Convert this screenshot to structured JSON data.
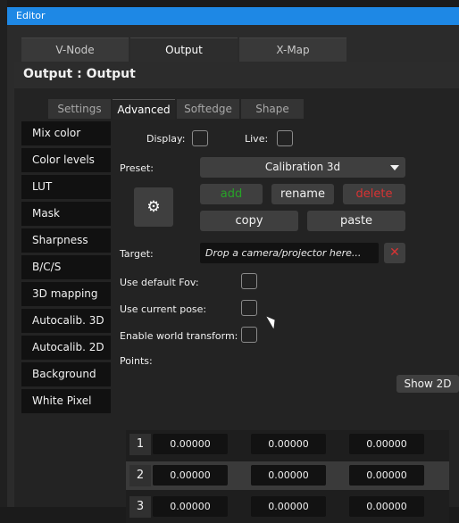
{
  "window": {
    "title": "Editor"
  },
  "top_tabs": [
    "V-Node",
    "Output",
    "X-Map"
  ],
  "header": {
    "title": "Output : Output"
  },
  "sub_tabs": [
    "Settings",
    "Advanced",
    "Softedge",
    "Shape"
  ],
  "nav": [
    "Mix color",
    "Color levels",
    "LUT",
    "Mask",
    "Sharpness",
    "B/C/S",
    "3D mapping",
    "Autocalib. 3D",
    "Autocalib. 2D",
    "Background",
    "White Pixel"
  ],
  "form": {
    "display_label": "Display:",
    "live_label": "Live:",
    "preset_label": "Preset:",
    "preset_value": "Calibration 3d",
    "add_label": "add",
    "rename_label": "rename",
    "delete_label": "delete",
    "copy_label": "copy",
    "paste_label": "paste",
    "gear_icon": "⚙",
    "target_label": "Target:",
    "target_placeholder": "Drop a camera/projector here...",
    "clear_icon": "✕",
    "default_fov_label": "Use default Fov:",
    "current_pose_label": "Use current pose:",
    "world_transform_label": "Enable world transform:",
    "points_label": "Points:",
    "show2d_label": "Show 2D"
  },
  "points": [
    {
      "index": "1",
      "values": [
        "0.00000",
        "0.00000",
        "0.00000"
      ]
    },
    {
      "index": "2",
      "values": [
        "0.00000",
        "0.00000",
        "0.00000"
      ]
    },
    {
      "index": "3",
      "values": [
        "0.00000",
        "0.00000",
        "0.00000"
      ]
    }
  ],
  "colors": {
    "titlebar": "#1e88e5",
    "add": "#27a327",
    "delete": "#d83333"
  }
}
